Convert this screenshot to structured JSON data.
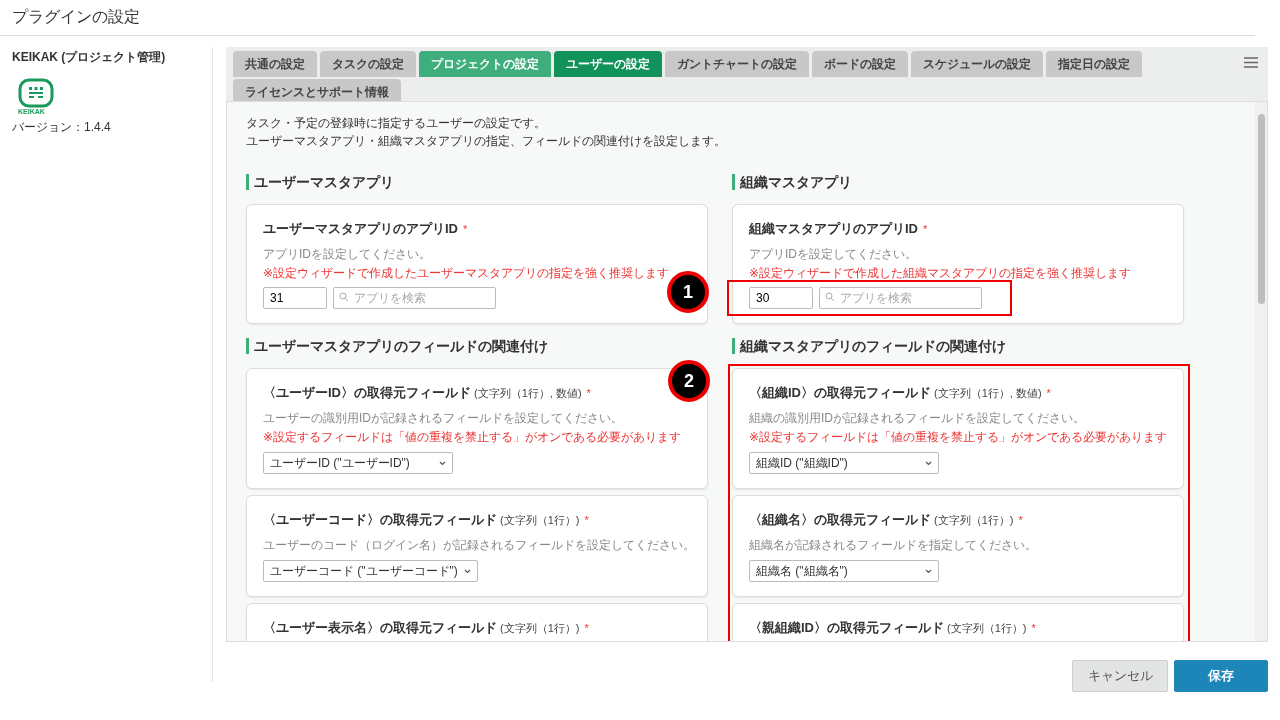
{
  "page_title": "プラグインの設定",
  "plugin": {
    "name": "KEIKAK (プロジェクト管理)",
    "logo_text": "KEIKAK",
    "version": "バージョン：1.4.4"
  },
  "tabs": [
    {
      "label": "共通の設定",
      "selected": false,
      "highlighted": false
    },
    {
      "label": "タスクの設定",
      "selected": false,
      "highlighted": false
    },
    {
      "label": "プロジェクトの設定",
      "selected": false,
      "highlighted": true
    },
    {
      "label": "ユーザーの設定",
      "selected": true,
      "highlighted": false
    },
    {
      "label": "ガントチャートの設定",
      "selected": false,
      "highlighted": false
    },
    {
      "label": "ボードの設定",
      "selected": false,
      "highlighted": false
    },
    {
      "label": "スケジュールの設定",
      "selected": false,
      "highlighted": false
    },
    {
      "label": "指定日の設定",
      "selected": false,
      "highlighted": false
    },
    {
      "label": "ライセンスとサポート情報",
      "selected": false,
      "highlighted": false
    }
  ],
  "intro": [
    "タスク・予定の登録時に指定するユーザーの設定です。",
    "ユーザーマスタアプリ・組織マスタアプリの指定、フィールドの関連付けを設定します。"
  ],
  "sections": [
    {
      "heading": "ユーザーマスタアプリ",
      "cards": [
        {
          "kind": "app_id",
          "title": "ユーザーマスタアプリのアプリID",
          "mark": "*",
          "description": "アプリIDを設定してください。",
          "warning": "※設定ウィザードで作成したユーザーマスタアプリの指定を強く推奨します",
          "value": "31",
          "search_placeholder": "アプリを検索"
        }
      ]
    },
    {
      "heading": "組織マスタアプリ",
      "cards": [
        {
          "kind": "app_id",
          "callout": "1",
          "title": "組織マスタアプリのアプリID",
          "mark": "*",
          "description": "アプリIDを設定してください。",
          "warning": "※設定ウィザードで作成した組織マスタアプリの指定を強く推奨します",
          "value": "30",
          "search_placeholder": "アプリを検索"
        }
      ]
    },
    {
      "heading": "ユーザーマスタアプリのフィールドの関連付け",
      "cards": [
        {
          "kind": "select",
          "title": "〈ユーザーID〉の取得元フィールド",
          "type": "(文字列（1行）, 数値)",
          "mark": "*",
          "description": "ユーザーの識別用IDが記録されるフィールドを設定してください。",
          "warning": "※設定するフィールドは「値の重複を禁止する」がオンである必要があります",
          "value": "ユーザーID (\"ユーザーID\")"
        },
        {
          "kind": "select",
          "title": "〈ユーザーコード〉の取得元フィールド",
          "type": "(文字列（1行）)",
          "mark": "*",
          "description": "ユーザーのコード（ログイン名）が記録されるフィールドを設定してください。",
          "value": "ユーザーコード (\"ユーザーコード\")"
        },
        {
          "kind": "select",
          "title": "〈ユーザー表示名〉の取得元フィールド",
          "type": "(文字列（1行）)",
          "mark": "*"
        }
      ]
    },
    {
      "heading": "組織マスタアプリのフィールドの関連付け",
      "callout": "2",
      "cards": [
        {
          "kind": "select",
          "title": "〈組織ID〉の取得元フィールド",
          "type": "(文字列（1行）, 数値)",
          "mark": "*",
          "description": "組織の識別用IDが記録されるフィールドを設定してください。",
          "warning": "※設定するフィールドは「値の重複を禁止する」がオンである必要があります",
          "value": "組織ID (\"組織ID\")"
        },
        {
          "kind": "select",
          "title": "〈組織名〉の取得元フィールド",
          "type": "(文字列（1行）)",
          "mark": "*",
          "description": "組織名が記録されるフィールドを指定してください。",
          "value": "組織名 (\"組織名\")"
        },
        {
          "kind": "select",
          "title": "〈親組織ID〉の取得元フィールド",
          "type": "(文字列（1行）)",
          "mark": "*"
        }
      ]
    }
  ],
  "buttons": {
    "cancel": "キャンセル",
    "save": "保存"
  }
}
